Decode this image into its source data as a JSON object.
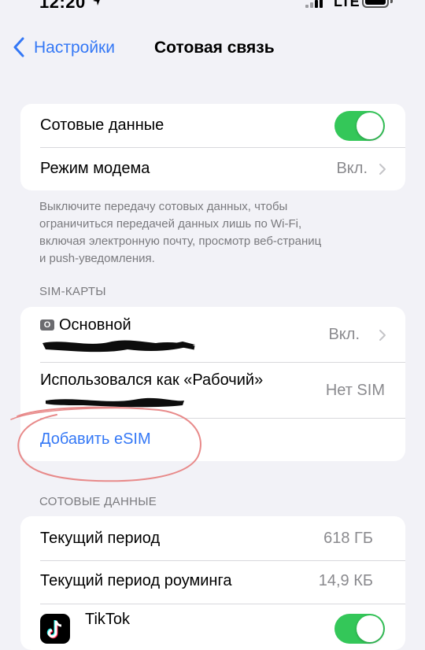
{
  "status_bar": {
    "time": "12:20",
    "network": "LTE"
  },
  "nav": {
    "back_label": "Настройки",
    "title": "Сотовая связь"
  },
  "cellular_group": {
    "cellular_data_label": "Сотовые данные",
    "cellular_data_on": true,
    "hotspot_label": "Режим модема",
    "hotspot_value": "Вкл."
  },
  "footnote": [
    "Выключите передачу сотовых данных, чтобы",
    "ограничиться передачей данных лишь по Wi-Fi,",
    "включая электронную почту, просмотр веб-страниц",
    "и push-уведомления."
  ],
  "sim_section": {
    "header": "SIM-КАРТЫ",
    "primary_badge": "О",
    "primary_label": "Основной",
    "primary_value": "Вкл.",
    "secondary_label": "Использовался как «Рабочий»",
    "secondary_value": "Нет SIM",
    "add_esim_label": "Добавить eSIM"
  },
  "data_section": {
    "header": "СОТОВЫЕ ДАННЫЕ",
    "current_period_label": "Текущий период",
    "current_period_value": "618 ГБ",
    "roaming_label": "Текущий период роуминга",
    "roaming_value": "14,9 КБ",
    "app_name": "TikTok",
    "app_toggle_on": true
  },
  "colors": {
    "accent": "#3478f6",
    "toggle_on": "#34c759",
    "annotation": "#e88a8a"
  }
}
